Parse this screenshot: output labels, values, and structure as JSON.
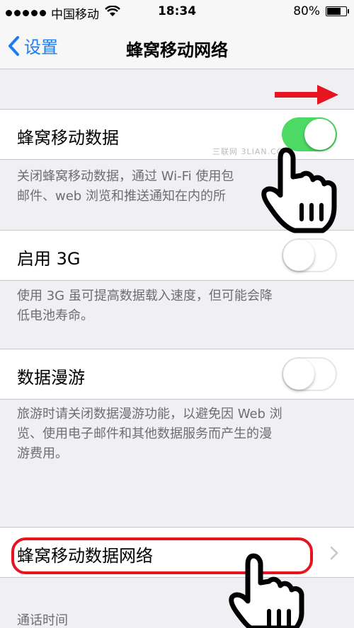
{
  "status_bar": {
    "carrier": "中国移动",
    "time": "18:34",
    "battery_level": "80%",
    "battery_fraction": 0.8
  },
  "nav": {
    "back_label": "设置",
    "title": "蜂窝移动网络"
  },
  "rows": {
    "cellular_data": {
      "label": "蜂窝移动数据",
      "enabled": true,
      "note_line1": "关闭蜂窝移动数据，通过 Wi-Fi 使用包",
      "note_line2": "邮件、web 浏览和推送通知在内的所"
    },
    "enable_3g": {
      "label": "启用 3G",
      "enabled": false,
      "note_line1": "使用 3G 虽可提高数据载入速度，但可能会降",
      "note_line2": "低电池寿命。"
    },
    "data_roaming": {
      "label": "数据漫游",
      "enabled": false,
      "note_line1": "旅游时请关闭数据漫游功能，以避免因 Web 浏",
      "note_line2": "览、使用电子邮件和其他数据服务而产生的漫",
      "note_line3": "游费用。"
    },
    "cellular_network": {
      "label": "蜂窝移动数据网络"
    }
  },
  "section_footer": "通话时间",
  "watermark": "三联网 3LIAN.COM",
  "colors": {
    "accent": "#1d7cf2",
    "toggle_on": "#4cd964",
    "annotation_red": "#e5141f"
  },
  "icons": [
    "signal-dots-icon",
    "wifi-icon",
    "battery-icon",
    "back-chevron-icon",
    "disclosure-chevron-icon",
    "red-arrow-icon",
    "pointing-hand-icon"
  ]
}
